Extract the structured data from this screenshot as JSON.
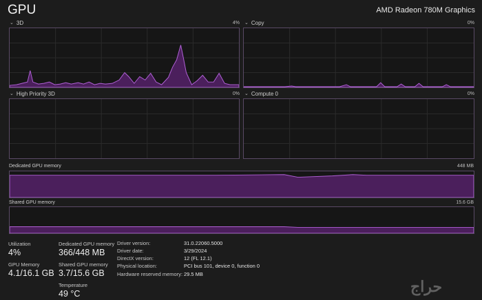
{
  "header": {
    "title": "GPU",
    "device": "AMD Radeon 780M Graphics"
  },
  "engines": [
    {
      "label": "3D",
      "percent": "4%"
    },
    {
      "label": "Copy",
      "percent": "0%"
    },
    {
      "label": "High Priority 3D",
      "percent": "0%"
    },
    {
      "label": "Compute 0",
      "percent": "0%"
    }
  ],
  "memory": {
    "dedicated": {
      "label": "Dedicated GPU memory",
      "capacity": "448 MB"
    },
    "shared": {
      "label": "Shared GPU memory",
      "capacity": "15.6 GB"
    }
  },
  "stats": {
    "utilization": {
      "label": "Utilization",
      "value": "4%"
    },
    "gpu_memory": {
      "label": "GPU Memory",
      "value": "4.1/16.1 GB"
    },
    "dedicated_memory": {
      "label": "Dedicated GPU memory",
      "value": "366/448 MB"
    },
    "shared_memory": {
      "label": "Shared GPU memory",
      "value": "3.7/15.6 GB"
    },
    "temperature": {
      "label": "Temperature",
      "value": "49 °C"
    }
  },
  "info": [
    {
      "key": "Driver version:",
      "value": "31.0.22060.5000"
    },
    {
      "key": "Driver date:",
      "value": "3/29/2024"
    },
    {
      "key": "DirectX version:",
      "value": "12 (FL 12.1)"
    },
    {
      "key": "Physical location:",
      "value": "PCI bus 101, device 0, function 0"
    },
    {
      "key": "Hardware reserved memory:",
      "value": "29.5 MB"
    }
  ],
  "watermark": "حراج",
  "colors": {
    "accent": "#9b4fc0",
    "fill": "#4b1f5c",
    "grid": "#2b2b2b"
  }
}
